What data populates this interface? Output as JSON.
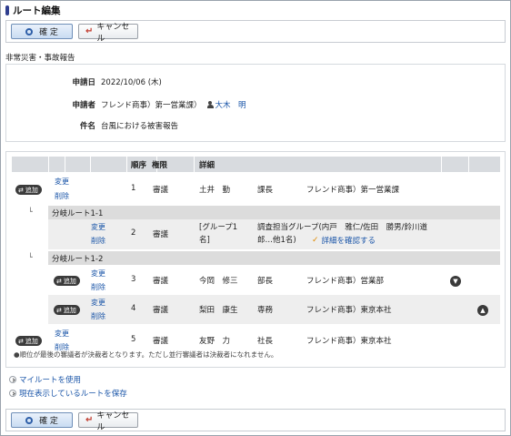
{
  "header": {
    "title": "ルート編集"
  },
  "toolbar": {
    "confirm_label": "確 定",
    "cancel_label": "キャンセル"
  },
  "section_title": "非常災害・事故報告",
  "info": {
    "date_label": "申請日",
    "date_value": "2022/10/06 (木)",
    "applicant_label": "申請者",
    "applicant_dept": "フレンド商事）第一営業課）",
    "applicant_name": "大木　明",
    "subject_label": "件名",
    "subject_value": "台風における被害報告"
  },
  "route": {
    "columns": [
      "順序",
      "権限",
      "詳細"
    ],
    "add_label": "追加",
    "change_label": "変更",
    "delete_label": "削除",
    "rows": [
      {
        "order": "1",
        "authority": "審議",
        "name": "土井　勤",
        "title": "課長",
        "dept": "フレンド商事）第一営業課"
      },
      {
        "order": "2",
        "authority": "審議",
        "name": "[グループ1名]",
        "group_detail": "調査担当グループ(内戸　雅仁/佐田　勝男/鈴川道郎…他1名)",
        "confirm_link": "詳細を確認する"
      },
      {
        "order": "3",
        "authority": "審議",
        "name": "今岡　修三",
        "title": "部長",
        "dept": "フレンド商事）営業部"
      },
      {
        "order": "4",
        "authority": "審議",
        "name": "梨田　康生",
        "title": "専務",
        "dept": "フレンド商事）東京本社"
      },
      {
        "order": "5",
        "authority": "審議",
        "name": "友野　力",
        "title": "社長",
        "dept": "フレンド商事）東京本社"
      }
    ],
    "branch1": "分岐ルート1-1",
    "branch2": "分岐ルート1-2",
    "branch_mark": "└",
    "note": "●順位が最後の審議者が決裁者となります。ただし並行審議者は決裁者になれません。"
  },
  "links": {
    "my_route": "マイルートを使用",
    "save_route": "現在表示しているルートを保存"
  }
}
